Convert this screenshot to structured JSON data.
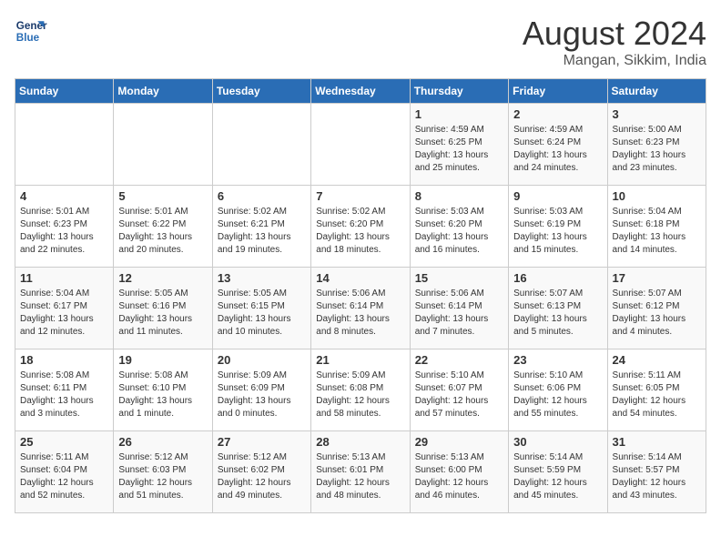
{
  "logo": {
    "line1": "General",
    "line2": "Blue"
  },
  "title": "August 2024",
  "location": "Mangan, Sikkim, India",
  "days_of_week": [
    "Sunday",
    "Monday",
    "Tuesday",
    "Wednesday",
    "Thursday",
    "Friday",
    "Saturday"
  ],
  "weeks": [
    [
      {
        "day": "",
        "info": ""
      },
      {
        "day": "",
        "info": ""
      },
      {
        "day": "",
        "info": ""
      },
      {
        "day": "",
        "info": ""
      },
      {
        "day": "1",
        "info": "Sunrise: 4:59 AM\nSunset: 6:25 PM\nDaylight: 13 hours\nand 25 minutes."
      },
      {
        "day": "2",
        "info": "Sunrise: 4:59 AM\nSunset: 6:24 PM\nDaylight: 13 hours\nand 24 minutes."
      },
      {
        "day": "3",
        "info": "Sunrise: 5:00 AM\nSunset: 6:23 PM\nDaylight: 13 hours\nand 23 minutes."
      }
    ],
    [
      {
        "day": "4",
        "info": "Sunrise: 5:01 AM\nSunset: 6:23 PM\nDaylight: 13 hours\nand 22 minutes."
      },
      {
        "day": "5",
        "info": "Sunrise: 5:01 AM\nSunset: 6:22 PM\nDaylight: 13 hours\nand 20 minutes."
      },
      {
        "day": "6",
        "info": "Sunrise: 5:02 AM\nSunset: 6:21 PM\nDaylight: 13 hours\nand 19 minutes."
      },
      {
        "day": "7",
        "info": "Sunrise: 5:02 AM\nSunset: 6:20 PM\nDaylight: 13 hours\nand 18 minutes."
      },
      {
        "day": "8",
        "info": "Sunrise: 5:03 AM\nSunset: 6:20 PM\nDaylight: 13 hours\nand 16 minutes."
      },
      {
        "day": "9",
        "info": "Sunrise: 5:03 AM\nSunset: 6:19 PM\nDaylight: 13 hours\nand 15 minutes."
      },
      {
        "day": "10",
        "info": "Sunrise: 5:04 AM\nSunset: 6:18 PM\nDaylight: 13 hours\nand 14 minutes."
      }
    ],
    [
      {
        "day": "11",
        "info": "Sunrise: 5:04 AM\nSunset: 6:17 PM\nDaylight: 13 hours\nand 12 minutes."
      },
      {
        "day": "12",
        "info": "Sunrise: 5:05 AM\nSunset: 6:16 PM\nDaylight: 13 hours\nand 11 minutes."
      },
      {
        "day": "13",
        "info": "Sunrise: 5:05 AM\nSunset: 6:15 PM\nDaylight: 13 hours\nand 10 minutes."
      },
      {
        "day": "14",
        "info": "Sunrise: 5:06 AM\nSunset: 6:14 PM\nDaylight: 13 hours\nand 8 minutes."
      },
      {
        "day": "15",
        "info": "Sunrise: 5:06 AM\nSunset: 6:14 PM\nDaylight: 13 hours\nand 7 minutes."
      },
      {
        "day": "16",
        "info": "Sunrise: 5:07 AM\nSunset: 6:13 PM\nDaylight: 13 hours\nand 5 minutes."
      },
      {
        "day": "17",
        "info": "Sunrise: 5:07 AM\nSunset: 6:12 PM\nDaylight: 13 hours\nand 4 minutes."
      }
    ],
    [
      {
        "day": "18",
        "info": "Sunrise: 5:08 AM\nSunset: 6:11 PM\nDaylight: 13 hours\nand 3 minutes."
      },
      {
        "day": "19",
        "info": "Sunrise: 5:08 AM\nSunset: 6:10 PM\nDaylight: 13 hours\nand 1 minute."
      },
      {
        "day": "20",
        "info": "Sunrise: 5:09 AM\nSunset: 6:09 PM\nDaylight: 13 hours\nand 0 minutes."
      },
      {
        "day": "21",
        "info": "Sunrise: 5:09 AM\nSunset: 6:08 PM\nDaylight: 12 hours\nand 58 minutes."
      },
      {
        "day": "22",
        "info": "Sunrise: 5:10 AM\nSunset: 6:07 PM\nDaylight: 12 hours\nand 57 minutes."
      },
      {
        "day": "23",
        "info": "Sunrise: 5:10 AM\nSunset: 6:06 PM\nDaylight: 12 hours\nand 55 minutes."
      },
      {
        "day": "24",
        "info": "Sunrise: 5:11 AM\nSunset: 6:05 PM\nDaylight: 12 hours\nand 54 minutes."
      }
    ],
    [
      {
        "day": "25",
        "info": "Sunrise: 5:11 AM\nSunset: 6:04 PM\nDaylight: 12 hours\nand 52 minutes."
      },
      {
        "day": "26",
        "info": "Sunrise: 5:12 AM\nSunset: 6:03 PM\nDaylight: 12 hours\nand 51 minutes."
      },
      {
        "day": "27",
        "info": "Sunrise: 5:12 AM\nSunset: 6:02 PM\nDaylight: 12 hours\nand 49 minutes."
      },
      {
        "day": "28",
        "info": "Sunrise: 5:13 AM\nSunset: 6:01 PM\nDaylight: 12 hours\nand 48 minutes."
      },
      {
        "day": "29",
        "info": "Sunrise: 5:13 AM\nSunset: 6:00 PM\nDaylight: 12 hours\nand 46 minutes."
      },
      {
        "day": "30",
        "info": "Sunrise: 5:14 AM\nSunset: 5:59 PM\nDaylight: 12 hours\nand 45 minutes."
      },
      {
        "day": "31",
        "info": "Sunrise: 5:14 AM\nSunset: 5:57 PM\nDaylight: 12 hours\nand 43 minutes."
      }
    ]
  ]
}
